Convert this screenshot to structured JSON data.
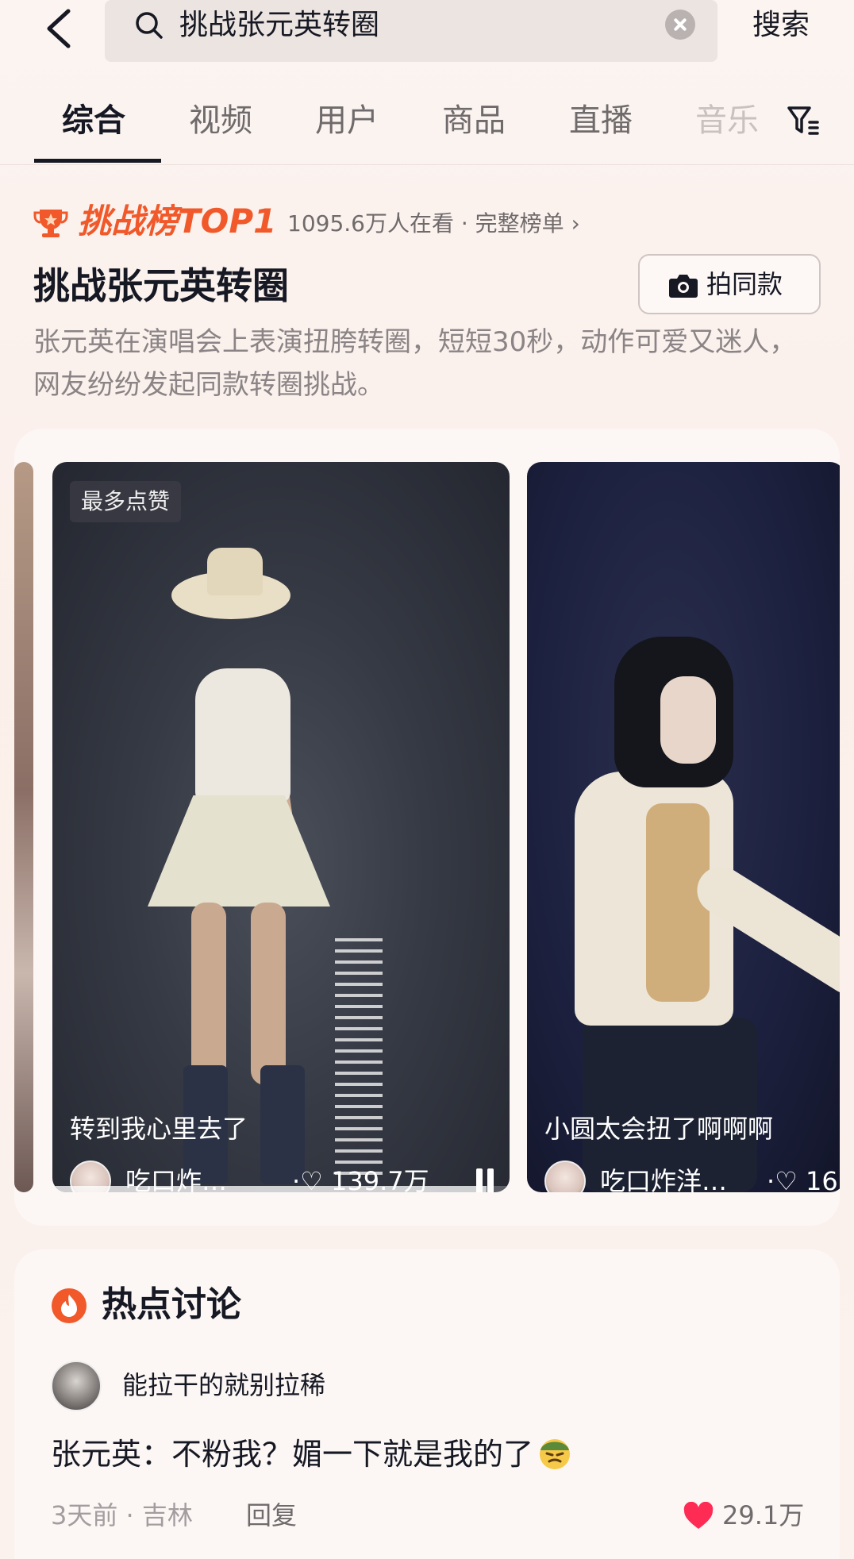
{
  "search": {
    "query": "挑战张元英转圈",
    "button_label": "搜索"
  },
  "tabs": [
    {
      "label": "综合",
      "active": true
    },
    {
      "label": "视频",
      "active": false
    },
    {
      "label": "用户",
      "active": false
    },
    {
      "label": "商品",
      "active": false
    },
    {
      "label": "直播",
      "active": false
    },
    {
      "label": "音乐",
      "active": false
    }
  ],
  "challenge": {
    "badge": "挑战榜TOP1",
    "meta": "1095.6万人在看 · 完整榜单 ›",
    "title": "挑战张元英转圈",
    "shoot_label": "拍同款",
    "description": "张元英在演唱会上表演扭胯转圈，短短30秒，动作可爱又迷人，网友纷纷发起同款转圈挑战。"
  },
  "videos": [
    {
      "tag": "最多点赞",
      "caption": "转到我心里去了",
      "author": "吃口炸…",
      "likes": "·♡ 139.7万",
      "progress": 0.95
    },
    {
      "caption": "小圆太会扭了啊啊啊",
      "author": "吃口炸洋…",
      "likes": "·♡ 16"
    }
  ],
  "discussion": {
    "title": "热点讨论",
    "username": "能拉干的就别拉稀",
    "comment": "张元英：不粉我？媚一下就是我的了",
    "meta": "3天前 · 吉林",
    "reply_label": "回复",
    "like_count": "29.1万"
  },
  "colors": {
    "accent": "#f1592a",
    "background": "#fbf2ee",
    "heart": "#fe2c55"
  }
}
